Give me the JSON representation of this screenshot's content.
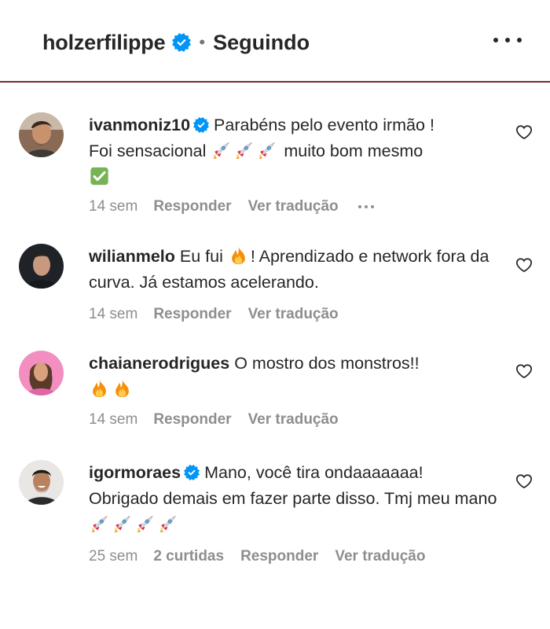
{
  "header": {
    "username": "holzerfilippe",
    "separator": "•",
    "following_label": "Seguindo",
    "more_icon": "more-horizontal-icon",
    "verified_icon": "verified-badge-icon"
  },
  "colors": {
    "verified_blue": "#0095f6",
    "secondary_text": "#8e8e8e",
    "primary_text": "#262626",
    "header_divider": "#7a2a2a"
  },
  "comments": [
    {
      "username": "ivanmoniz10",
      "verified": true,
      "text_line1": "Parabéns pelo evento irmão !",
      "text_line2_a": "Foi sensacional",
      "text_line2_b": "muito bom mesmo",
      "emojis": [
        "rocket",
        "rocket",
        "rocket",
        "check-mark"
      ],
      "time": "14 sem",
      "reply_label": "Responder",
      "translate_label": "Ver tradução",
      "has_more": true
    },
    {
      "username": "wilianmelo",
      "verified": false,
      "text_a": "Eu fui",
      "text_b": "! Aprendizado e network fora da curva. Já estamos acelerando.",
      "emojis": [
        "fire"
      ],
      "time": "14 sem",
      "reply_label": "Responder",
      "translate_label": "Ver tradução"
    },
    {
      "username": "chaianerodrigues",
      "verified": false,
      "text": "O mostro dos monstros!!",
      "emojis": [
        "fire",
        "fire"
      ],
      "time": "14 sem",
      "reply_label": "Responder",
      "translate_label": "Ver tradução"
    },
    {
      "username": "igormoraes",
      "verified": true,
      "text": "Mano, você tira ondaaaaaaa! Obrigado demais em fazer parte disso. Tmj meu mano",
      "emojis": [
        "rocket",
        "rocket",
        "rocket",
        "rocket"
      ],
      "time": "25 sem",
      "likes_label": "2 curtidas",
      "reply_label": "Responder",
      "translate_label": "Ver tradução"
    }
  ]
}
